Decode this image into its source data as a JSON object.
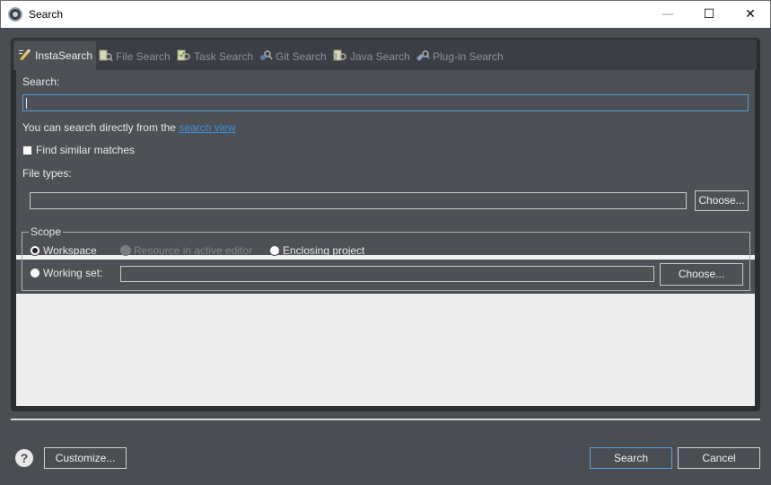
{
  "window": {
    "title": "Search",
    "minimize_glyph": "—",
    "maximize_glyph": "☐",
    "close_glyph": "✕"
  },
  "tabs": [
    {
      "label": "InstaSearch",
      "icon": "instasearch-icon",
      "active": true
    },
    {
      "label": "File Search",
      "icon": "file-search-icon",
      "active": false
    },
    {
      "label": "Task Search",
      "icon": "task-search-icon",
      "active": false
    },
    {
      "label": "Git Search",
      "icon": "git-search-icon",
      "active": false
    },
    {
      "label": "Java Search",
      "icon": "java-search-icon",
      "active": false
    },
    {
      "label": "Plug-in Search",
      "icon": "plugin-search-icon",
      "active": false
    }
  ],
  "search": {
    "label": "Search:",
    "value": "",
    "hint_prefix": "You can search directly from the ",
    "hint_link": "search view",
    "similar_label": "Find similar matches",
    "similar_checked": false,
    "filetypes_label": "File types:",
    "filetypes_value": "",
    "choose_label": "Choose..."
  },
  "scope": {
    "title": "Scope",
    "workspace_label": "Workspace",
    "workspace_selected": true,
    "resource_label": "Resource in active editor",
    "enclosing_label": "Enclosing project",
    "workingset_label": "Working set:",
    "workingset_value": "",
    "choose_label": "Choose..."
  },
  "footer": {
    "help_glyph": "?",
    "customize_label": "Customize...",
    "search_label": "Search",
    "cancel_label": "Cancel"
  },
  "colors": {
    "background": "#4a4e52",
    "panel": "#4d5155",
    "link": "#3d8fe0",
    "focus": "#4f9fe0"
  }
}
